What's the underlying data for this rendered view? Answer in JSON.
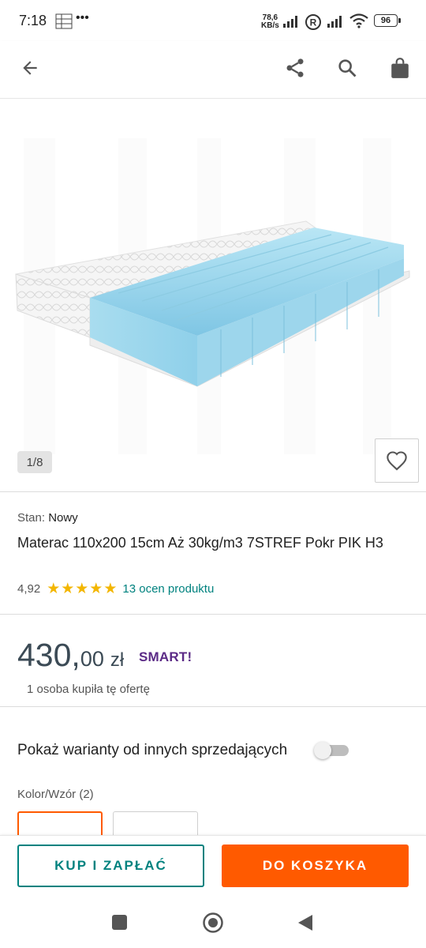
{
  "status_bar": {
    "time": "7:18",
    "speed_value": "78,6",
    "speed_unit": "KB/s",
    "battery": "96"
  },
  "gallery": {
    "counter": "1/8"
  },
  "product": {
    "condition_label": "Stan:",
    "condition_value": "Nowy",
    "title": "Materac 110x200 15cm Aż 30kg/m3 7STREF Pokr PIK H3",
    "rating": "4,92",
    "stars": "★★★★★",
    "reviews": "13 ocen produktu"
  },
  "price": {
    "integer": "430,",
    "decimal": "00",
    "currency": "zł",
    "smart_label": "SMART!",
    "bought_info": "1 osoba kupiła tę ofertę"
  },
  "variants": {
    "toggle_label": "Pokaż warianty od innych sprzedających",
    "toggle_on": false,
    "color_label": "Kolor/Wzór (2)"
  },
  "actions": {
    "buy_label": "KUP I ZAPŁAĆ",
    "cart_label": "DO KOSZYKA"
  },
  "colors": {
    "teal": "#00827f",
    "orange": "#ff5a00",
    "smart_purple": "#5b2a86",
    "star": "#f3b600"
  },
  "icons": [
    "back-arrow-icon",
    "share-icon",
    "search-icon",
    "shopping-bag-icon",
    "heart-icon",
    "star-icon",
    "nav-recents-icon",
    "nav-home-icon",
    "nav-back-icon"
  ]
}
